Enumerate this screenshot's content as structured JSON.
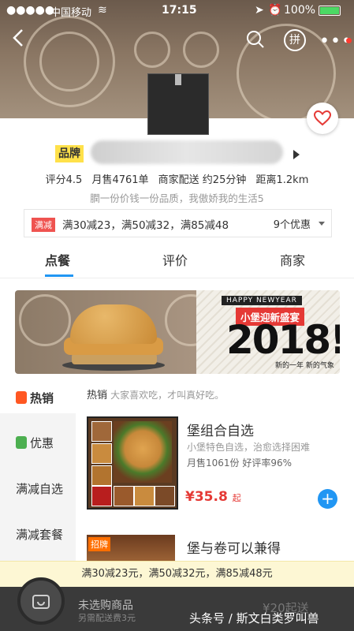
{
  "status_bar": {
    "carrier": "中国移动",
    "time": "17:15",
    "battery": "100%"
  },
  "header": {
    "brand_tag": "品牌"
  },
  "store_info": {
    "rating": "评分4.5",
    "monthly_sales": "月售4761单",
    "delivery_mode": "商家配送 约25分钟",
    "distance": "距离1.2km",
    "slogan": "膶一份价钱一份品质，我傲娇我的生活5"
  },
  "promo_row": {
    "badge": "满减",
    "text": "满30减23，满50减32，满85减48",
    "more": "9个优惠"
  },
  "tabs": [
    {
      "label": "点餐"
    },
    {
      "label": "评价"
    },
    {
      "label": "商家"
    }
  ],
  "ad_banner": {
    "top_line": "HAPPY NEWYEAR",
    "headline": "小堡迎新盛宴",
    "year": "2018!",
    "subline": "新的一年 新的气象"
  },
  "sidebar": {
    "items": [
      {
        "label": "热销"
      },
      {
        "label": "优惠"
      },
      {
        "label": "满减自选"
      },
      {
        "label": "满减套餐"
      }
    ]
  },
  "section": {
    "title": "热销",
    "subtitle": "大家喜欢吃，才叫真好吃。"
  },
  "products": [
    {
      "name": "堡组合自选",
      "desc": "小堡特色自选，治愈选择困难",
      "sales": "月售1061份  好评率96%",
      "price": "¥35.8",
      "price_suffix": "起"
    },
    {
      "badge": "招牌",
      "name": "堡与卷可以兼得"
    }
  ],
  "promo_bar": {
    "text": "满30减23元，满50减32元，满85减48元"
  },
  "cart_bar": {
    "label": "未选购商品",
    "sub": "另需配送费3元",
    "delivery": "¥20起送"
  },
  "watermark": "头条号 / 斯文白类罗叫兽",
  "colors": {
    "accent": "#2196f3",
    "price": "#e53935",
    "brand_tag": "#ffe14a"
  }
}
